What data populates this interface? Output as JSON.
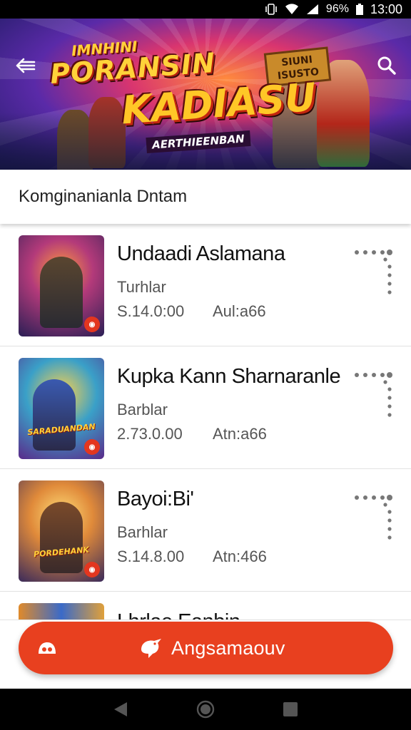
{
  "status_bar": {
    "battery": "96%",
    "time": "13:00"
  },
  "banner": {
    "title_line0": "IMNHINI",
    "title_line1": "PORANSIN",
    "title_line2": "KADIASU",
    "subtitle": "AERTHIEENBAN",
    "sign_text": "SIUNI ISUSTO"
  },
  "section": {
    "title": "Komginanianla Dntam"
  },
  "list": {
    "items": [
      {
        "title": "Undaadi Aslamana",
        "subtitle": "Turhlar",
        "size": "S.14.0:00",
        "date": "Aul:a66",
        "thumb_text": ""
      },
      {
        "title": "Kupka Kann Sharnaranle",
        "subtitle": "Barblar",
        "size": "2.73.0.00",
        "date": "Atn:a66",
        "thumb_text": "SARADUANDAN"
      },
      {
        "title": "Bayoi:Bi'",
        "subtitle": "Barhlar",
        "size": "S.14.8.00",
        "date": "Atn:466",
        "thumb_text": "PORDEHANK"
      }
    ],
    "partial_title": "Lhrlae Eanbin"
  },
  "action": {
    "label": "Angsamaouv"
  },
  "colors": {
    "accent": "#e8401f",
    "badge": "#e3361f"
  }
}
